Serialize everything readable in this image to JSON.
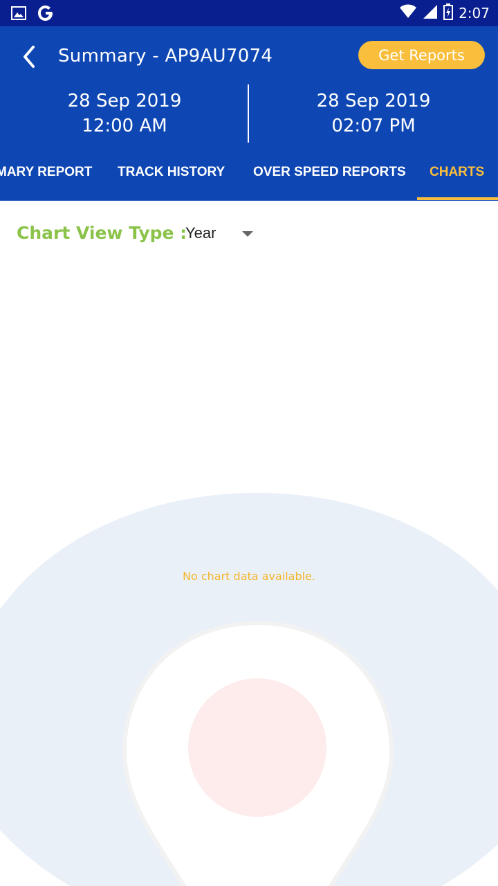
{
  "status_bar": {
    "time": "2:07",
    "icons": [
      "image-icon",
      "google-icon",
      "wifi-icon",
      "signal-icon",
      "battery-charging-icon"
    ]
  },
  "header": {
    "title": "Summary - AP9AU7074",
    "get_reports_label": "Get Reports",
    "from": {
      "date": "28 Sep 2019",
      "time": "12:00 AM"
    },
    "to": {
      "date": "28 Sep 2019",
      "time": "02:07 PM"
    }
  },
  "tabs": [
    {
      "label": "MARY REPORT"
    },
    {
      "label": "TRACK HISTORY"
    },
    {
      "label": "OVER SPEED REPORTS"
    },
    {
      "label": "CHARTS",
      "active": true
    }
  ],
  "chart_view": {
    "label": "Chart View Type :",
    "selected": "Year"
  },
  "empty_message": "No chart data available.",
  "colors": {
    "status_bar": "#0a1f8f",
    "header": "#0e47b3",
    "accent": "#f9be3c",
    "label_green": "#8bc34a",
    "empty_text": "#f5b52a"
  }
}
